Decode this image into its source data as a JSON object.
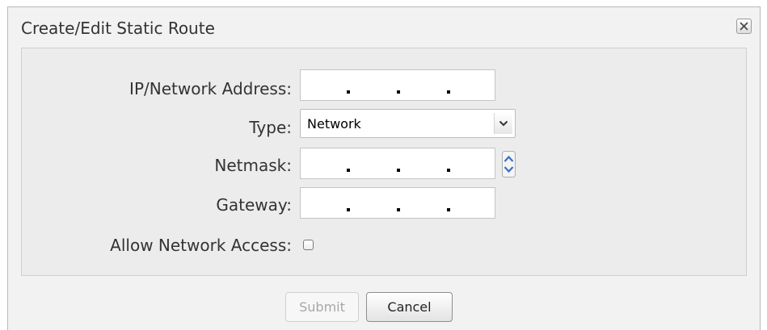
{
  "dialog": {
    "title": "Create/Edit Static Route",
    "close_icon": "close-x-icon"
  },
  "form": {
    "ip_label": "IP/Network Address:",
    "ip_value": ". . .",
    "type_label": "Type:",
    "type_value": "Network",
    "type_icon": "chevron-down-icon",
    "netmask_label": "Netmask:",
    "netmask_value": ". . .",
    "netmask_spinner_icon": "up-down-spinner-icon",
    "gateway_label": "Gateway:",
    "gateway_value": ". . .",
    "allow_label": "Allow Network Access:",
    "allow_checked": false
  },
  "buttons": {
    "submit_label": "Submit",
    "cancel_label": "Cancel"
  },
  "colors": {
    "dialog_bg": "#f2f2f2",
    "content_bg": "#ececec",
    "text": "#333333",
    "disabled_text": "#a8a8a8",
    "spinner_blue": "#3a6fc4"
  }
}
